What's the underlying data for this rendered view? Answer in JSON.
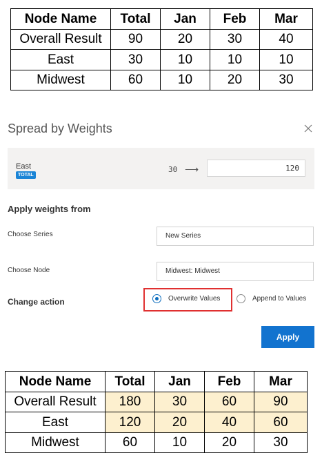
{
  "tables": {
    "headers": [
      "Node Name",
      "Total",
      "Jan",
      "Feb",
      "Mar"
    ],
    "before": {
      "rows": [
        [
          "Overall Result",
          "90",
          "20",
          "30",
          "40"
        ],
        [
          "East",
          "30",
          "10",
          "10",
          "10"
        ],
        [
          "Midwest",
          "60",
          "10",
          "20",
          "30"
        ]
      ]
    },
    "after": {
      "rows": [
        [
          "Overall Result",
          "180",
          "30",
          "60",
          "90"
        ],
        [
          "East",
          "120",
          "20",
          "40",
          "60"
        ],
        [
          "Midwest",
          "60",
          "10",
          "20",
          "30"
        ]
      ]
    }
  },
  "dialog": {
    "title": "Spread by Weights",
    "close_icon": "close-icon",
    "source": {
      "node_name": "East",
      "badge": "TOTAL",
      "from_value": "30",
      "arrow_icon": "arrow-right-icon",
      "to_value": "120"
    },
    "section_title": "Apply weights from",
    "choose_series": {
      "label": "Choose Series",
      "value": "New Series"
    },
    "choose_node": {
      "label": "Choose Node",
      "value": "Midwest: Midwest"
    },
    "change_action": {
      "label": "Change action",
      "options": [
        {
          "label": "Overwrite Values",
          "selected": true
        },
        {
          "label": "Append to Values",
          "selected": false
        }
      ]
    },
    "apply_label": "Apply"
  },
  "colors": {
    "accent": "#1273cf",
    "highlight_cell": "#fdf0cf",
    "annotation_box": "#e03030"
  }
}
